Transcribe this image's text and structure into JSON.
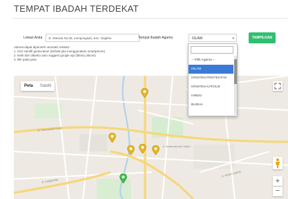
{
  "page": {
    "title": "TEMPAT IBADAH TERDEKAT"
  },
  "form": {
    "location_label": "Lokasi Anda",
    "location_value": "Jl. Veteran No.29, Lempongsari, Kec. Gajahm",
    "religion_label": "Tempat Ibadah Agama",
    "religion_value": "ISLAM",
    "show_button": "TAMPILKAN"
  },
  "notes": [
    "Alamat dapat diperoleh otomatis melalui :",
    "1. Izin/ Hentifi geolocation (terbaik jika menggunakan smartphone)",
    "2. ketik dan dibantu auto suggest google api (library places)",
    "3. klik pada peta"
  ],
  "dropdown": {
    "items": [
      "-- Pilih Agama --",
      "ISLAM",
      "KRISTEN PROTESTAN",
      "KRISTEN KATOLIK",
      "HINDU",
      "BUDHA"
    ],
    "selected_index": 1
  },
  "map": {
    "tabs": [
      "Peta",
      "Satelit"
    ],
    "active_tab": "Peta",
    "zoom_in": "+",
    "zoom_out": "−",
    "streets": [
      "Jl. Pamularsih Raya",
      "Jl. Abdurrahman Saleh",
      "Jl. Kaligarang",
      "Jl. Kelud Raya",
      "Jl. Sultan Agung"
    ],
    "colors": {
      "place_pin": "#e7b622",
      "user_pin": "#3fbf4a",
      "road_major": "#f6d77a",
      "land": "#eeeae3"
    }
  }
}
